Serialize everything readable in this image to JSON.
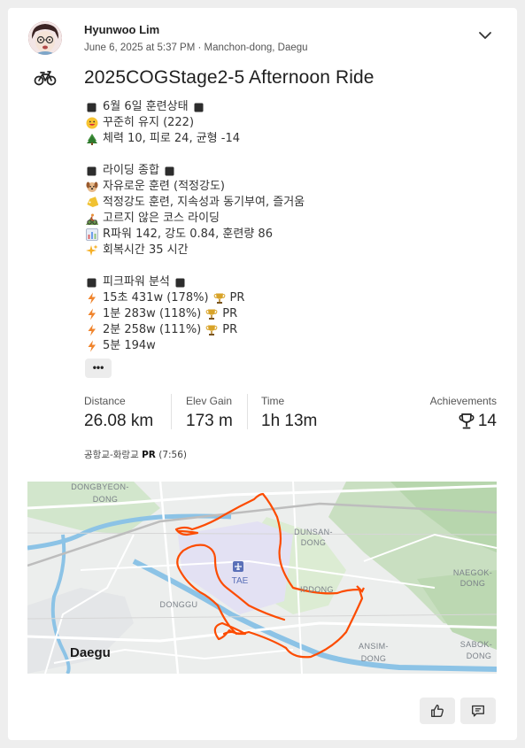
{
  "athlete": {
    "name": "Hyunwoo Lim",
    "meta": "June 6, 2025 at 5:37 PM · Manchon-dong, Daegu"
  },
  "activity": {
    "title": "2025COGStage2-5 Afternoon Ride",
    "sport_icon": "bike-icon"
  },
  "description": {
    "lines": [
      {
        "icon": "black-square",
        "text": "6월 6일 훈련상태",
        "suffix_icon": "black-square"
      },
      {
        "icon": "grinning-face",
        "text": "꾸준히 유지 (222)"
      },
      {
        "icon": "tree",
        "text": "체력 10, 피로 24, 균형 -14"
      },
      {
        "icon": "",
        "text": ""
      },
      {
        "icon": "black-square",
        "text": "라이딩 종합",
        "suffix_icon": "black-square"
      },
      {
        "icon": "dog-face",
        "text": "자유로운 훈련 (적정강도)"
      },
      {
        "icon": "label-tag",
        "text": "적정강도 훈련, 지속성과 동기부여, 즐거움"
      },
      {
        "icon": "mountain-biker",
        "text": "고르지 않은 코스 라이딩"
      },
      {
        "icon": "bar-chart",
        "text": "R파워 142, 강도 0.84, 훈련량 86"
      },
      {
        "icon": "sparkles",
        "text": "회복시간 35 시간"
      },
      {
        "icon": "",
        "text": ""
      },
      {
        "icon": "black-square",
        "text": "피크파워 분석",
        "suffix_icon": "black-square"
      },
      {
        "icon": "lightning",
        "text": "15초 431w (178%)",
        "trophy": "PR"
      },
      {
        "icon": "lightning",
        "text": "1분 283w (118%)",
        "trophy": "PR"
      },
      {
        "icon": "lightning",
        "text": "2분 258w (111%)",
        "trophy": "PR"
      },
      {
        "icon": "lightning",
        "text": "5분 194w"
      }
    ],
    "more_label": "•••"
  },
  "stats": {
    "distance": {
      "label": "Distance",
      "value": "26.08 km"
    },
    "elev_gain": {
      "label": "Elev Gain",
      "value": "173 m"
    },
    "time": {
      "label": "Time",
      "value": "1h 13m"
    },
    "achievements": {
      "label": "Achievements",
      "value": "14"
    }
  },
  "segment": {
    "name": "공항교-화랑교",
    "badge": "PR",
    "time": "(7:56)"
  },
  "map": {
    "labels": {
      "dongbyeon": "DONGBYEON-",
      "dongbyeon2": "DONG",
      "dunsan": "DUNSAN-",
      "dunsan2": "DONG",
      "naegok": "NAEGOK-",
      "naegok2": "DONG",
      "airport": "TAE",
      "ipdong": "IPDONG",
      "donggu": "DONGGU",
      "ansim": "ANSIM-",
      "ansim2": "DONG",
      "sabok": "SABOK-",
      "sabok2": "DONG",
      "daegu": "Daegu"
    },
    "route_color": "#fc4c02"
  },
  "actions": {
    "kudos_icon": "thumbs-up-icon",
    "comment_icon": "comment-icon"
  },
  "colors": {
    "accent": "#fc4c02",
    "background": "#eeeeee",
    "card": "#ffffff"
  }
}
